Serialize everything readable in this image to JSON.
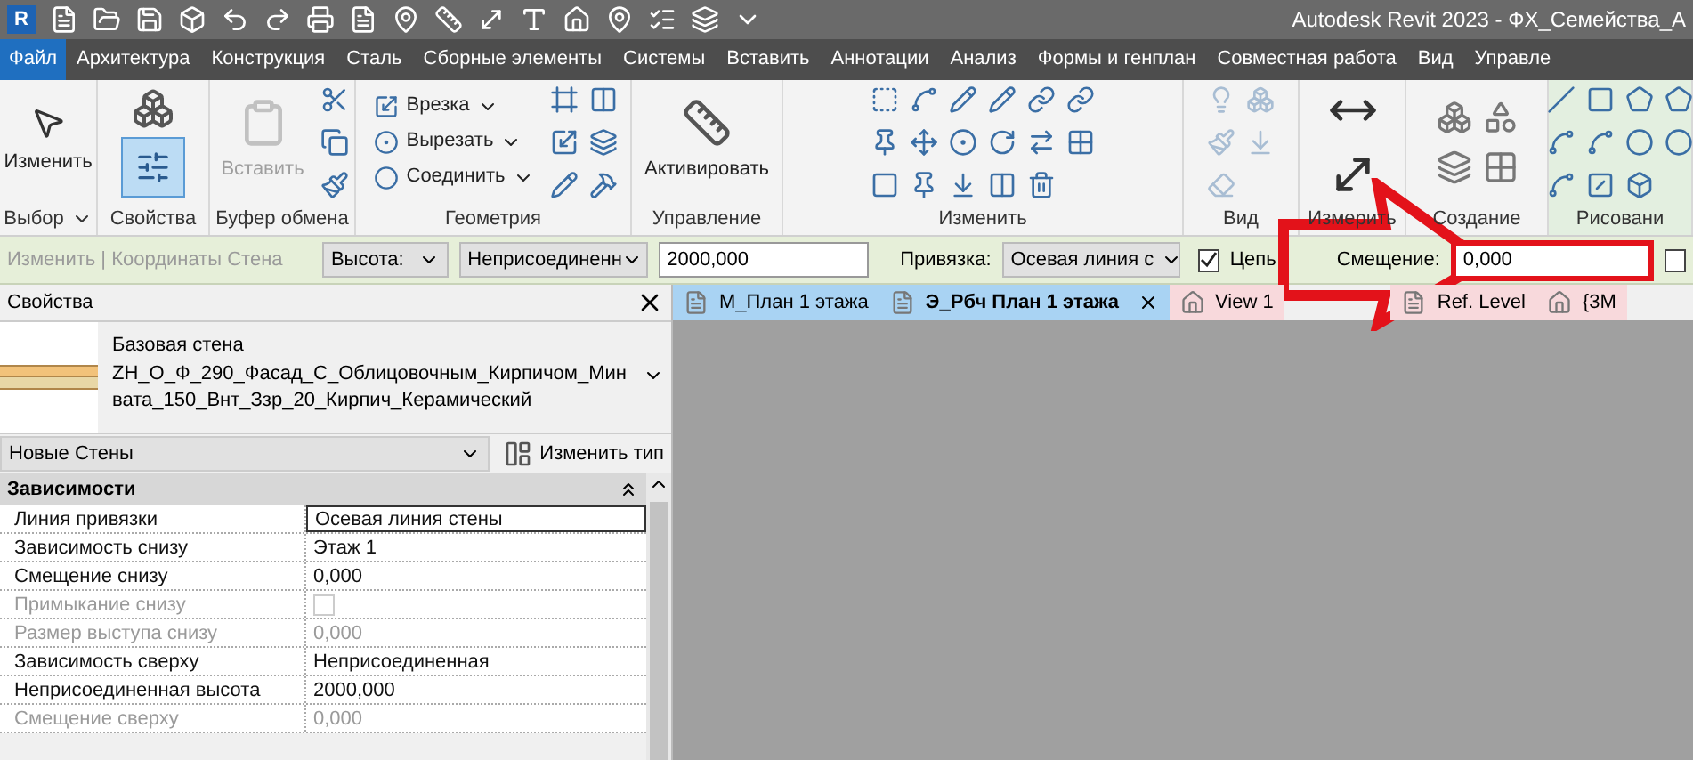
{
  "window": {
    "app_logo": "R",
    "title": "Autodesk Revit 2023 - ФХ_Семейства_А"
  },
  "ribbon_tabs": [
    {
      "label": "Файл",
      "kind": "file"
    },
    {
      "label": "Архитектура",
      "kind": "tab"
    },
    {
      "label": "Конструкция",
      "kind": "tab"
    },
    {
      "label": "Сталь",
      "kind": "tab"
    },
    {
      "label": "Сборные элементы",
      "kind": "tab"
    },
    {
      "label": "Системы",
      "kind": "tab"
    },
    {
      "label": "Вставить",
      "kind": "tab"
    },
    {
      "label": "Аннотации",
      "kind": "tab"
    },
    {
      "label": "Анализ",
      "kind": "tab"
    },
    {
      "label": "Формы и генплан",
      "kind": "tab"
    },
    {
      "label": "Совместная работа",
      "kind": "tab"
    },
    {
      "label": "Вид",
      "kind": "tab"
    },
    {
      "label": "Управле",
      "kind": "tab"
    }
  ],
  "ribbon_panels": [
    {
      "title": "Выбор",
      "menu": true,
      "tools": [
        {
          "kind": "large",
          "label": "Изменить",
          "selected": false,
          "disabled": false
        }
      ]
    },
    {
      "title": "Свойства",
      "menu": false,
      "tools": [
        {
          "kind": "stack",
          "selected": true,
          "disabled": false
        }
      ]
    },
    {
      "title": "Буфер обмена",
      "menu": false,
      "tools": [
        {
          "kind": "large",
          "label": "Вставить",
          "selected": false,
          "disabled": true
        },
        {
          "kind": "icons",
          "selected": false,
          "disabled": false
        }
      ]
    },
    {
      "title": "Геометрия",
      "menu": false,
      "tools": [
        {
          "kind": "small",
          "label": "Врезка",
          "selected": false,
          "disabled": false
        },
        {
          "kind": "small",
          "label": "Вырезать",
          "selected": false,
          "disabled": false
        },
        {
          "kind": "small",
          "label": "Соединить",
          "selected": false,
          "disabled": false
        },
        {
          "kind": "icons",
          "selected": false,
          "disabled": false
        }
      ]
    },
    {
      "title": "Управление",
      "menu": false,
      "tools": [
        {
          "kind": "large",
          "label": "Активировать",
          "selected": false,
          "disabled": false
        }
      ]
    },
    {
      "title": "Изменить",
      "menu": false,
      "tools": [
        {
          "kind": "icons",
          "selected": false,
          "disabled": false
        }
      ]
    },
    {
      "title": "Вид",
      "menu": false,
      "tools": [
        {
          "kind": "icons",
          "selected": false,
          "disabled": true
        }
      ]
    },
    {
      "title": "Измерить",
      "menu": false,
      "tools": [
        {
          "kind": "icons",
          "selected": false,
          "disabled": false
        }
      ]
    },
    {
      "title": "Создание",
      "menu": false,
      "tools": [
        {
          "kind": "icons",
          "selected": false,
          "disabled": false
        }
      ]
    },
    {
      "title": "Рисовани",
      "menu": false,
      "tools": [
        {
          "kind": "icons",
          "selected": false,
          "disabled": false
        }
      ]
    }
  ],
  "options_bar": {
    "context": "Изменить | Координаты Стена",
    "height_mode": "Высота:",
    "height_constraint": "Неприсоединенн",
    "height_value": "2000,000",
    "location_line_label": "Привязка:",
    "location_line": "Осевая линия с",
    "chain": {
      "label": "Цепь",
      "checked": true
    },
    "offset_label": "Смещение:",
    "offset_value": "0,000",
    "radius_checked": false
  },
  "properties": {
    "title": "Свойства",
    "family": "Базовая стена",
    "type_name": "ZH_О_Ф_290_Фасад_С_Облицовочным_Кирпичом_Минвата_150_Внт_Ззр_20_Кирпич_Керамический",
    "instance_filter": "Новые Стены",
    "edit_type": "Изменить тип",
    "group": {
      "title": "Зависимости",
      "expanded": true
    },
    "rows": [
      {
        "name": "Линия привязки",
        "value": "Осевая линия стены",
        "kind": "field",
        "disabled": false
      },
      {
        "name": "Зависимость снизу",
        "value": "Этаж 1",
        "kind": "text",
        "disabled": false
      },
      {
        "name": "Смещение снизу",
        "value": "0,000",
        "kind": "text",
        "disabled": false
      },
      {
        "name": "Примыкание снизу",
        "kind": "checkbox",
        "checked": false,
        "disabled": true
      },
      {
        "name": "Размер выступа снизу",
        "value": "0,000",
        "kind": "text",
        "disabled": true
      },
      {
        "name": "Зависимость сверху",
        "value": "Неприсоединенная",
        "kind": "text",
        "disabled": false
      },
      {
        "name": "Неприсоединенная высота",
        "value": "2000,000",
        "kind": "text",
        "disabled": false
      },
      {
        "name": "Смещение сверху",
        "value": "0,000",
        "kind": "text",
        "disabled": true
      }
    ]
  },
  "view_tabs": [
    {
      "label": "М_План 1 этажа",
      "kind": "plan",
      "selected": false,
      "color": "#a9d3f3"
    },
    {
      "label": "Э_Рбч План 1 этажа",
      "kind": "plan",
      "selected": true,
      "color": "#a9d3f3"
    },
    {
      "label": "View 1",
      "kind": "model",
      "selected": false,
      "color": "#f8d9dc"
    },
    {
      "label": "Ref. Level",
      "kind": "plan",
      "selected": false,
      "color": "#f8d9dc"
    },
    {
      "label": "{3М",
      "kind": "model",
      "selected": false,
      "color": "#f8d9dc"
    }
  ]
}
